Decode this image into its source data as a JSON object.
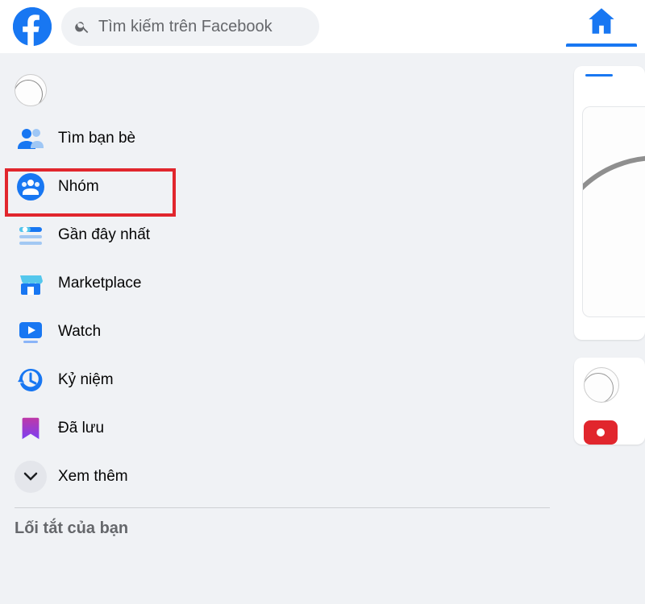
{
  "header": {
    "search_placeholder": "Tìm kiếm trên Facebook",
    "home_label": "Trang chủ"
  },
  "sidebar": {
    "items": [
      {
        "id": "profile",
        "label": "",
        "icon": "profile-avatar"
      },
      {
        "id": "find-friends",
        "label": "Tìm bạn bè",
        "icon": "friends-icon"
      },
      {
        "id": "groups",
        "label": "Nhóm",
        "icon": "groups-icon"
      },
      {
        "id": "most-recent",
        "label": "Gần đây nhất",
        "icon": "recent-icon"
      },
      {
        "id": "marketplace",
        "label": "Marketplace",
        "icon": "marketplace-icon"
      },
      {
        "id": "watch",
        "label": "Watch",
        "icon": "watch-icon"
      },
      {
        "id": "memories",
        "label": "Kỷ niệm",
        "icon": "memories-icon"
      },
      {
        "id": "saved",
        "label": "Đã lưu",
        "icon": "saved-icon"
      },
      {
        "id": "see-more",
        "label": "Xem thêm",
        "icon": "chevron-down-icon"
      }
    ],
    "shortcuts_title": "Lối tắt của bạn",
    "highlighted_item": "groups"
  },
  "colors": {
    "brand": "#1877f2",
    "highlight": "#e1262d"
  }
}
